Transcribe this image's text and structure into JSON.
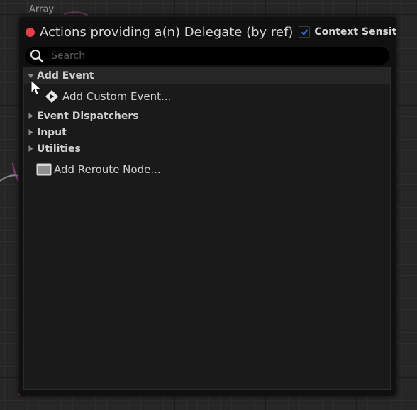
{
  "background": {
    "node_label": "Array"
  },
  "panel": {
    "title": "Actions providing a(n) Delegate (by ref)",
    "title_dot_color": "#e2414a",
    "context_sensitive": {
      "label": "Context Sensitiv",
      "checked": true,
      "check_color": "#2b7fe0"
    }
  },
  "search": {
    "placeholder": "Search",
    "value": ""
  },
  "tree": {
    "add_event": {
      "label": "Add Event",
      "expanded": true,
      "children": [
        {
          "label": "Add Custom Event...",
          "icon": "custom-event-diamond-icon"
        }
      ]
    },
    "categories": [
      {
        "label": "Event Dispatchers",
        "expanded": false
      },
      {
        "label": "Input",
        "expanded": false
      },
      {
        "label": "Utilities",
        "expanded": false
      }
    ],
    "reroute": {
      "label": "Add Reroute Node...",
      "icon": "reroute-node-icon"
    }
  }
}
